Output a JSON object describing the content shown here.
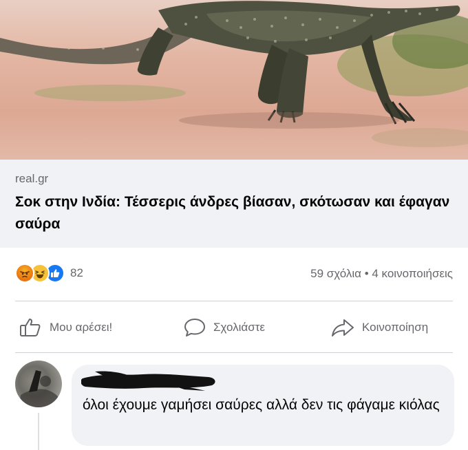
{
  "post": {
    "link": {
      "domain": "real.gr",
      "headline": "Σοκ στην Ινδία: Τέσσερις άνδρες βίασαν, σκότωσαν και έφαγαν σαύρα"
    },
    "stats": {
      "reactions": [
        "angry-reaction-icon",
        "haha-reaction-icon",
        "like-reaction-icon"
      ],
      "reaction_count": "82",
      "comments_shares": "59 σχόλια • 4 κοινοποιήσεις"
    },
    "actions": {
      "like": "Μου αρέσει!",
      "comment": "Σχολιάστε",
      "share": "Κοινοποίηση"
    }
  },
  "comment": {
    "text": "όλοι έχουμε γαμήσει σαύρες αλλά δεν τις φάγαμε κιόλας"
  },
  "colors": {
    "link_background": "#f0f2f5",
    "secondary_text": "#65676b",
    "primary_text": "#050505",
    "like_blue": "#1877f2"
  }
}
